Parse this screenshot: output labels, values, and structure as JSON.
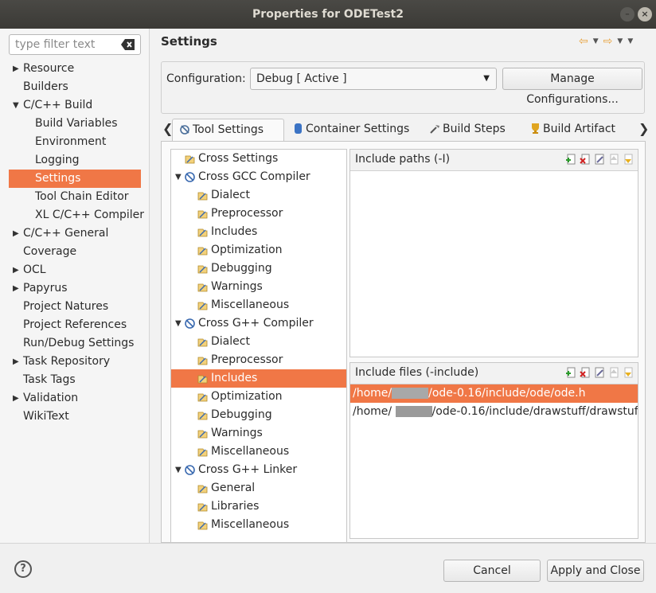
{
  "window": {
    "title": "Properties for ODETest2"
  },
  "filter": {
    "placeholder": "type filter text"
  },
  "nav": [
    {
      "label": "Resource",
      "expander": "collapsed",
      "level": 0
    },
    {
      "label": "Builders",
      "expander": "none",
      "level": 0
    },
    {
      "label": "C/C++ Build",
      "expander": "expanded",
      "level": 0
    },
    {
      "label": "Build Variables",
      "expander": "none",
      "level": 1
    },
    {
      "label": "Environment",
      "expander": "none",
      "level": 1
    },
    {
      "label": "Logging",
      "expander": "none",
      "level": 1
    },
    {
      "label": "Settings",
      "expander": "none",
      "level": 1,
      "selected": true
    },
    {
      "label": "Tool Chain Editor",
      "expander": "none",
      "level": 1
    },
    {
      "label": "XL C/C++ Compiler",
      "expander": "none",
      "level": 1
    },
    {
      "label": "C/C++ General",
      "expander": "collapsed",
      "level": 0
    },
    {
      "label": "Coverage",
      "expander": "none",
      "level": 0
    },
    {
      "label": "OCL",
      "expander": "collapsed",
      "level": 0
    },
    {
      "label": "Papyrus",
      "expander": "collapsed",
      "level": 0
    },
    {
      "label": "Project Natures",
      "expander": "none",
      "level": 0
    },
    {
      "label": "Project References",
      "expander": "none",
      "level": 0
    },
    {
      "label": "Run/Debug Settings",
      "expander": "none",
      "level": 0
    },
    {
      "label": "Task Repository",
      "expander": "collapsed",
      "level": 0
    },
    {
      "label": "Task Tags",
      "expander": "none",
      "level": 0
    },
    {
      "label": "Validation",
      "expander": "collapsed",
      "level": 0
    },
    {
      "label": "WikiText",
      "expander": "none",
      "level": 0
    }
  ],
  "settings": {
    "title": "Settings",
    "configuration_label": "Configuration:",
    "configuration_value": "Debug  [ Active ]",
    "manage_button": "Manage Configurations..."
  },
  "tabs": [
    {
      "label": "Tool Settings",
      "icon": "tool-settings-icon",
      "active": true
    },
    {
      "label": "Container Settings",
      "icon": "container-icon",
      "active": false
    },
    {
      "label": "Build Steps",
      "icon": "build-steps-icon",
      "active": false
    },
    {
      "label": "Build Artifact",
      "icon": "trophy-icon",
      "active": false
    }
  ],
  "tool_tree": [
    {
      "label": "Cross Settings",
      "level": 0,
      "expander": "none",
      "icon": "settings-leaf-icon"
    },
    {
      "label": "Cross GCC Compiler",
      "level": 0,
      "expander": "expanded",
      "icon": "compiler-icon"
    },
    {
      "label": "Dialect",
      "level": 1,
      "expander": "none",
      "icon": "settings-leaf-icon"
    },
    {
      "label": "Preprocessor",
      "level": 1,
      "expander": "none",
      "icon": "settings-leaf-icon"
    },
    {
      "label": "Includes",
      "level": 1,
      "expander": "none",
      "icon": "settings-leaf-icon"
    },
    {
      "label": "Optimization",
      "level": 1,
      "expander": "none",
      "icon": "settings-leaf-icon"
    },
    {
      "label": "Debugging",
      "level": 1,
      "expander": "none",
      "icon": "settings-leaf-icon"
    },
    {
      "label": "Warnings",
      "level": 1,
      "expander": "none",
      "icon": "settings-leaf-icon"
    },
    {
      "label": "Miscellaneous",
      "level": 1,
      "expander": "none",
      "icon": "settings-leaf-icon"
    },
    {
      "label": "Cross G++ Compiler",
      "level": 0,
      "expander": "expanded",
      "icon": "compiler-icon"
    },
    {
      "label": "Dialect",
      "level": 1,
      "expander": "none",
      "icon": "settings-leaf-icon"
    },
    {
      "label": "Preprocessor",
      "level": 1,
      "expander": "none",
      "icon": "settings-leaf-icon"
    },
    {
      "label": "Includes",
      "level": 1,
      "expander": "none",
      "icon": "settings-leaf-icon",
      "selected": true
    },
    {
      "label": "Optimization",
      "level": 1,
      "expander": "none",
      "icon": "settings-leaf-icon"
    },
    {
      "label": "Debugging",
      "level": 1,
      "expander": "none",
      "icon": "settings-leaf-icon"
    },
    {
      "label": "Warnings",
      "level": 1,
      "expander": "none",
      "icon": "settings-leaf-icon"
    },
    {
      "label": "Miscellaneous",
      "level": 1,
      "expander": "none",
      "icon": "settings-leaf-icon"
    },
    {
      "label": "Cross G++ Linker",
      "level": 0,
      "expander": "expanded",
      "icon": "compiler-icon"
    },
    {
      "label": "General",
      "level": 1,
      "expander": "none",
      "icon": "settings-leaf-icon"
    },
    {
      "label": "Libraries",
      "level": 1,
      "expander": "none",
      "icon": "settings-leaf-icon"
    },
    {
      "label": "Miscellaneous",
      "level": 1,
      "expander": "none",
      "icon": "settings-leaf-icon"
    }
  ],
  "include_paths": {
    "header": "Include paths (-I)",
    "items": []
  },
  "include_files": {
    "header": "Include files (-include)",
    "items": [
      {
        "prefix": "/home/",
        "suffix": "/ode-0.16/include/ode/ode.h",
        "selected": true
      },
      {
        "prefix": "/home/ ",
        "suffix": "/ode-0.16/include/drawstuff/drawstuf",
        "selected": false
      }
    ]
  },
  "footer": {
    "help": "?",
    "cancel": "Cancel",
    "apply_close": "Apply and Close"
  },
  "colors": {
    "selection": "#f07746",
    "titlebar": "#3c3b37"
  }
}
